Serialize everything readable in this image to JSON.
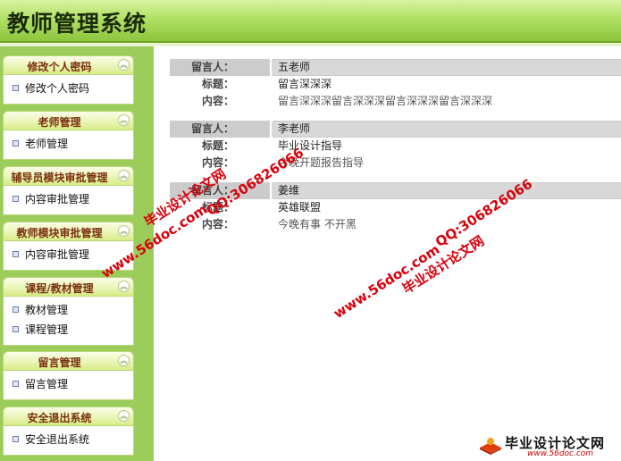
{
  "app": {
    "title": "教师管理系统"
  },
  "sidebar": {
    "groups": [
      {
        "title": "修改个人密码",
        "items": [
          "修改个人密码"
        ]
      },
      {
        "title": "老师管理",
        "items": [
          "老师管理"
        ]
      },
      {
        "title": "辅导员模块审批管理",
        "items": [
          "内容审批管理"
        ]
      },
      {
        "title": "教师模块审批管理",
        "items": [
          "内容审批管理"
        ]
      },
      {
        "title": "课程/教材管理",
        "items": [
          "教材管理",
          "课程管理"
        ]
      },
      {
        "title": "留言管理",
        "items": [
          "留言管理"
        ]
      },
      {
        "title": "安全退出系统",
        "items": [
          "安全退出系统"
        ]
      }
    ]
  },
  "labels": {
    "author": "留言人：",
    "subject": "标题：",
    "body": "内容："
  },
  "messages": [
    {
      "author": "五老师",
      "subject": "留言深深深",
      "body": "留言深深深留言深深深留言深深深留言深深深"
    },
    {
      "author": "李老师",
      "subject": "毕业设计指导",
      "body": "今晚开题报告指导"
    },
    {
      "author": "姜维",
      "subject": "英雄联盟",
      "body": "今晚有事  不开黑"
    }
  ],
  "watermarks": {
    "site": "www.56doc.com",
    "qq": "QQ:306826066",
    "brand": "毕业设计论文网"
  },
  "footer": {
    "logo_text": "毕业设计论文网",
    "logo_url": "www.56doc.com"
  },
  "colors": {
    "header": "#8cc63d",
    "sidebar": "#9ccd5b",
    "group_title": "#7a2e0e",
    "watermark": "#d9000c"
  }
}
